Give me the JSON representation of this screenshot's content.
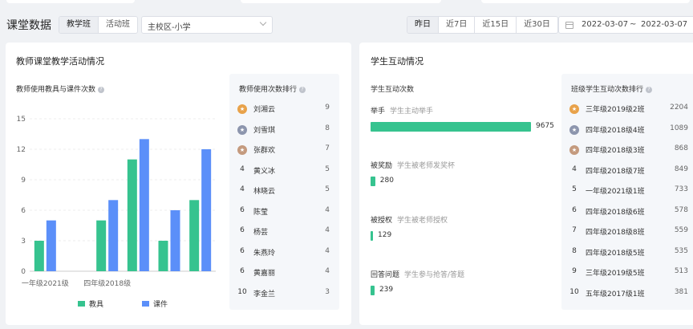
{
  "header": {
    "title": "课堂数据",
    "class_tabs": [
      "教学班",
      "活动班"
    ],
    "campus_select": "主校区-小学",
    "period_tabs": [
      "昨日",
      "近7日",
      "近15日",
      "近30日"
    ],
    "date_start": "2022-03-07",
    "date_sep": "~",
    "date_end": "2022-03-07"
  },
  "teacher_card": {
    "title": "教师课堂教学活动情况",
    "chart_title": "教师使用教具与课件次数",
    "ranking_title": "教师使用次数排行",
    "ranking": [
      {
        "rank": "1",
        "name": "刘湘云",
        "count": "9"
      },
      {
        "rank": "2",
        "name": "刘雪琪",
        "count": "8"
      },
      {
        "rank": "3",
        "name": "张群欢",
        "count": "7"
      },
      {
        "rank": "4",
        "name": "黄义冰",
        "count": "5"
      },
      {
        "rank": "4",
        "name": "林晓云",
        "count": "5"
      },
      {
        "rank": "6",
        "name": "陈莹",
        "count": "4"
      },
      {
        "rank": "6",
        "name": "杨芸",
        "count": "4"
      },
      {
        "rank": "6",
        "name": "朱燕玲",
        "count": "4"
      },
      {
        "rank": "6",
        "name": "黄嘉丽",
        "count": "4"
      },
      {
        "rank": "10",
        "name": "李金兰",
        "count": "3"
      }
    ]
  },
  "chart_data": {
    "type": "bar",
    "title": "教师使用教具与课件次数",
    "categories": [
      "一年级2021级",
      "",
      "四年级2018级",
      "",
      "",
      ""
    ],
    "x_tick_labels": [
      {
        "label": "一年级2021级",
        "at": 0
      },
      {
        "label": "四年级2018级",
        "at": 2
      }
    ],
    "series": [
      {
        "name": "教具",
        "color": "#36c38f",
        "values": [
          3,
          0,
          5,
          11,
          3,
          7
        ]
      },
      {
        "name": "课件",
        "color": "#5b8ff9",
        "values": [
          5,
          0,
          7,
          13,
          6,
          12
        ]
      }
    ],
    "ylim": [
      0,
      15
    ],
    "yticks": [
      "0",
      "3",
      "6",
      "9",
      "12",
      "15"
    ],
    "grid": true,
    "legend_position": "bottom"
  },
  "student_card": {
    "title": "学生互动情况",
    "subtitle": "学生互动次数",
    "max_value": 9675,
    "interactions": [
      {
        "label": "举手",
        "desc": "学生主动举手",
        "value": 9675,
        "value_text": "9675"
      },
      {
        "label": "被奖励",
        "desc": "学生被老师发奖杯",
        "value": 280,
        "value_text": "280"
      },
      {
        "label": "被授权",
        "desc": "学生被老师授权",
        "value": 129,
        "value_text": "129"
      },
      {
        "label": "回答问题",
        "desc": "学生参与抢答/答题",
        "value": 239,
        "value_text": "239"
      }
    ],
    "ranking_title": "班级学生互动次数排行",
    "ranking": [
      {
        "rank": "1",
        "name": "三年级2019级2班",
        "count": "2204"
      },
      {
        "rank": "2",
        "name": "四年级2018级4班",
        "count": "1089"
      },
      {
        "rank": "3",
        "name": "四年级2018级3班",
        "count": "868"
      },
      {
        "rank": "4",
        "name": "四年级2018级7班",
        "count": "849"
      },
      {
        "rank": "5",
        "name": "一年级2021级1班",
        "count": "733"
      },
      {
        "rank": "6",
        "name": "四年级2018级6班",
        "count": "578"
      },
      {
        "rank": "7",
        "name": "四年级2018级8班",
        "count": "559"
      },
      {
        "rank": "8",
        "name": "四年级2018级5班",
        "count": "535"
      },
      {
        "rank": "9",
        "name": "三年级2019级5班",
        "count": "513"
      },
      {
        "rank": "10",
        "name": "五年级2017级1班",
        "count": "381"
      }
    ]
  },
  "colors": {
    "gold": "#e8a24a",
    "silver": "#8c95ad",
    "bronze": "#c49a7e",
    "green": "#36c38f",
    "blue": "#5b8ff9"
  }
}
